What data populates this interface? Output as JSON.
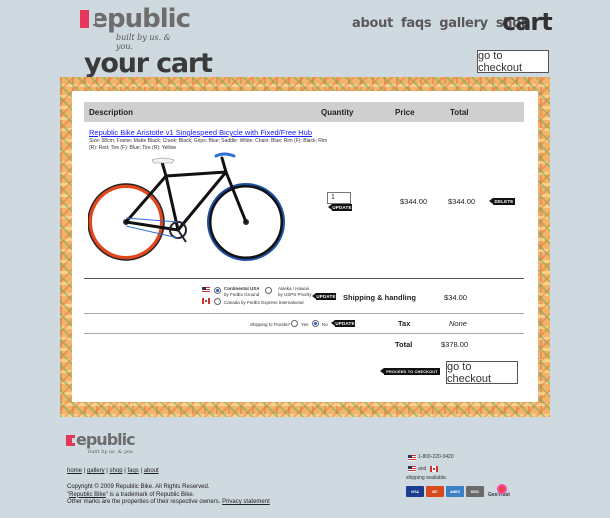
{
  "brand": {
    "name_rest": "epublic",
    "tagline": "built by us. & you."
  },
  "nav": {
    "about": "about",
    "faqs": "faqs",
    "gallery": "gallery",
    "shop": "shop",
    "cart": "cart"
  },
  "page_title": "your cart",
  "checkout_label": "go to checkout",
  "table": {
    "headers": {
      "description": "Description",
      "quantity": "Quantity",
      "price": "Price",
      "total": "Total"
    }
  },
  "item": {
    "name": "Republic Bike Aristotle v1 Singlespeed Bicycle with Fixed/Free Hub",
    "options": "Size: 58cm; Frame: Matte Black; Crank: Black; Grips: Blue; Saddle: White; Chain: Blue; Rim (F): Black; Rim (R): Red; Tire (F): Blue; Tire (R): Yellow",
    "quantity": "1",
    "update_label": "UPDATE",
    "price": "$344.00",
    "total": "$344.00",
    "delete_label": "DELETE",
    "colors": {
      "frame": "#111111",
      "front_tire": "#1e4fa8",
      "rear_rim": "#e2461c",
      "grips": "#2f6fd8"
    }
  },
  "shipping": {
    "opt1_title": "Continental USA",
    "opt1_sub": "by FedEx Ground",
    "opt2_title": "Alaska / Hawaii",
    "opt2_sub": "by USPS Priority",
    "opt3": "Canada by FedEx Express International",
    "update_label": "UPDATE",
    "label": "Shipping & handling",
    "value": "$34.00"
  },
  "tax": {
    "question": "Shipping to Florida?",
    "yes": "Yes",
    "no": "No",
    "update_label": "UPDATE",
    "label": "Tax",
    "value": "None"
  },
  "total": {
    "label": "Total",
    "value": "$378.00"
  },
  "proceed_label": "PROCEED TO CHECKOUT",
  "footer": {
    "links": {
      "home": "home",
      "gallery": "gallery",
      "shop": "shop",
      "faqs": "faqs",
      "about": "about",
      "sep": "|"
    },
    "copyright": "Copyright © 2009 Republic Bike. All Rights Reserved.",
    "trademark_link": "Republic Bike",
    "trademark_rest": " is a trademark of Republic Bike.",
    "other_prefix": "Other marks are the properties of their respective owners. ",
    "privacy": "Privacy statement",
    "phone": "1-800-220-3420",
    "and": "and",
    "shipping_available": "shipping available.",
    "cards": [
      "VISA",
      "MC",
      "AMEX",
      "DISC"
    ],
    "geotrust": "GeoTrust"
  }
}
